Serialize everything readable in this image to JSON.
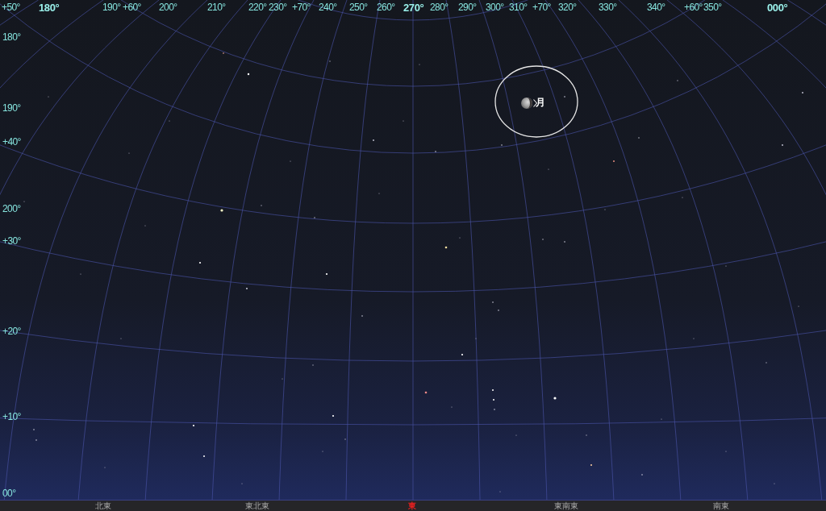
{
  "top_labels": [
    {
      "text": "+50°",
      "major": false
    },
    {
      "text": "180°",
      "major": true
    },
    {
      "text": "190°",
      "major": false
    },
    {
      "text": "+60°",
      "major": false
    },
    {
      "text": "200°",
      "major": false
    },
    {
      "text": "210°",
      "major": false
    },
    {
      "text": "220°",
      "major": false
    },
    {
      "text": "230°",
      "major": false
    },
    {
      "text": "+70°",
      "major": false
    },
    {
      "text": "240°",
      "major": false
    },
    {
      "text": "250°",
      "major": false
    },
    {
      "text": "260°",
      "major": false
    },
    {
      "text": "270°",
      "major": true
    },
    {
      "text": "280°",
      "major": false
    },
    {
      "text": "290°",
      "major": false
    },
    {
      "text": "300°",
      "major": false
    },
    {
      "text": "310°",
      "major": false
    },
    {
      "text": "+70°",
      "major": false
    },
    {
      "text": "320°",
      "major": false
    },
    {
      "text": "330°",
      "major": false
    },
    {
      "text": "340°",
      "major": false
    },
    {
      "text": "+60°",
      "major": false
    },
    {
      "text": "350°",
      "major": false
    },
    {
      "text": "000°",
      "major": true
    }
  ],
  "left_labels": [
    "180°",
    "190°",
    "+40°",
    "200°",
    "+30°",
    "+20°",
    "+10°",
    "00°"
  ],
  "moon": {
    "label": "月"
  },
  "directions": [
    {
      "label": "北東",
      "selected": false
    },
    {
      "label": "東北東",
      "selected": false
    },
    {
      "label": "東",
      "selected": true
    },
    {
      "label": "東南東",
      "selected": false
    },
    {
      "label": "南東",
      "selected": false
    }
  ]
}
